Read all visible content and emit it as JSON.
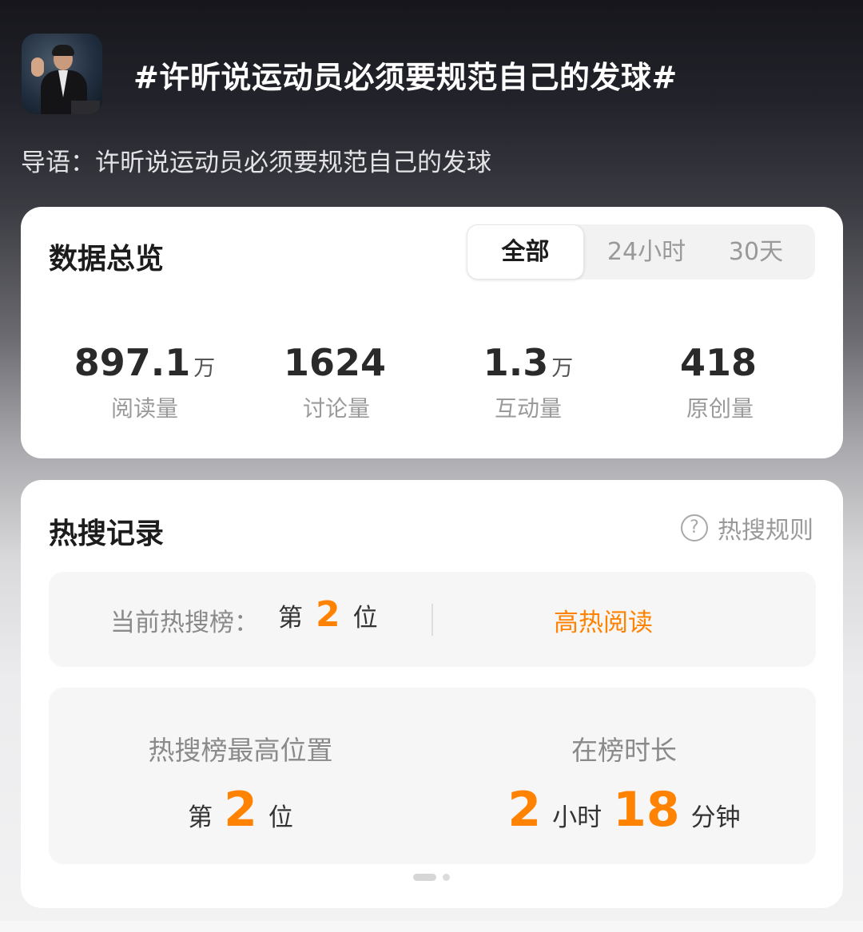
{
  "header": {
    "title": "#许昕说运动员必须要规范自己的发球#",
    "intro": "导语：许昕说运动员必须要规范自己的发球"
  },
  "overview": {
    "title": "数据总览",
    "tabs": [
      {
        "label": "全部",
        "selected": true
      },
      {
        "label": "24小时",
        "selected": false
      },
      {
        "label": "30天",
        "selected": false
      }
    ],
    "stats": [
      {
        "value": "897.1",
        "unit": "万",
        "label": "阅读量"
      },
      {
        "value": "1624",
        "unit": "",
        "label": "讨论量"
      },
      {
        "value": "1.3",
        "unit": "万",
        "label": "互动量"
      },
      {
        "value": "418",
        "unit": "",
        "label": "原创量"
      }
    ]
  },
  "hot": {
    "title": "热搜记录",
    "rule_label": "热搜规则",
    "rule_icon": "question-icon",
    "current_label": "当前热搜榜：",
    "current_prefix": "第",
    "current_rank": "2",
    "current_suffix": "位",
    "link_label": "高热阅读",
    "best_title": "热搜榜最高位置",
    "best_prefix": "第",
    "best_rank": "2",
    "best_suffix": "位",
    "duration_title": "在榜时长",
    "duration_hours": "2",
    "duration_hours_unit": "小时",
    "duration_minutes": "18",
    "duration_minutes_unit": "分钟"
  },
  "colors": {
    "accent": "#ff8200",
    "card_bg": "#ffffff",
    "muted_text": "#9a9a9a"
  }
}
